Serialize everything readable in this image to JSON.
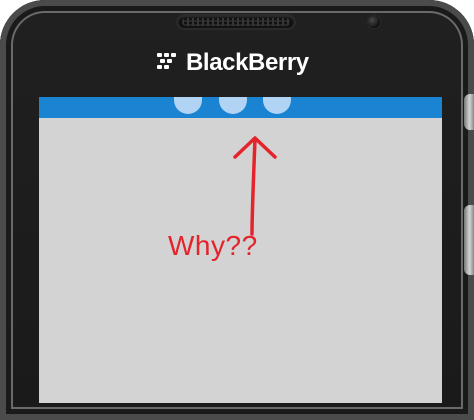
{
  "device": {
    "brand_name": "BlackBerry",
    "logo_icon": "blackberry-logo-icon",
    "body_color": "#1f1f1f",
    "screen_color": "#d3d3d3",
    "accent_color": "#1b84d2"
  },
  "screen": {
    "indicator_dots_count": 3,
    "indicator_dot_color": "#b9d8f6"
  },
  "annotation": {
    "text": "Why??",
    "arrow_icon": "upward-arrow-icon",
    "color": "#e3242b"
  }
}
